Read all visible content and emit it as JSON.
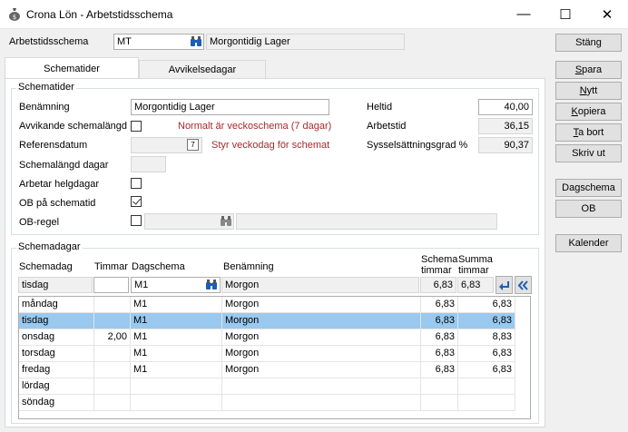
{
  "window": {
    "title": "Crona Lön - Arbetstidsschema",
    "min": "—",
    "max": "☐",
    "close": "✕"
  },
  "header": {
    "label": "Arbetstidsschema",
    "code": "MT",
    "name": "Morgontidig Lager"
  },
  "tabs": [
    {
      "label": "Schematider"
    },
    {
      "label": "Avvikelsedagar"
    }
  ],
  "schematider": {
    "title": "Schematider",
    "benamning_label": "Benämning",
    "benamning_value": "Morgontidig Lager",
    "avvikande_label": "Avvikande schemalängd",
    "avvikande_note": "Normalt är veckoschema (7 dagar)",
    "referensdatum_label": "Referensdatum",
    "referensdatum_note": "Styr veckodag för schemat",
    "calendar_glyph": "7",
    "schemalangd_label": "Schemalängd dagar",
    "arbetar_helgdagar_label": "Arbetar helgdagar",
    "ob_pa_schematid_label": "OB på schematid",
    "ob_regel_label": "OB-regel",
    "heltid_label": "Heltid",
    "heltid_value": "40,00",
    "arbetstid_label": "Arbetstid",
    "arbetstid_value": "36,15",
    "syss_label": "Sysselsättningsgrad %",
    "syss_value": "90,37"
  },
  "schemadagar": {
    "title": "Schemadagar",
    "col_schemadag": "Schemadag",
    "col_timmar": "Timmar",
    "col_dagschema": "Dagschema",
    "col_benamning": "Benämning",
    "col_schema_timmar_1": "Schema",
    "col_schema_timmar_2": "timmar",
    "col_summa_timmar_1": "Summa",
    "col_summa_timmar_2": "timmar",
    "edit": {
      "day": "tisdag",
      "timmar": "",
      "dagschema": "M1",
      "benamning": "Morgon",
      "schema_timmar": "6,83",
      "summa_timmar": "6,83"
    },
    "rows": [
      {
        "day": "måndag",
        "timmar": "",
        "dagschema": "M1",
        "benamning": "Morgon",
        "schema_timmar": "6,83",
        "summa_timmar": "6,83"
      },
      {
        "day": "tisdag",
        "timmar": "",
        "dagschema": "M1",
        "benamning": "Morgon",
        "schema_timmar": "6,83",
        "summa_timmar": "6,83"
      },
      {
        "day": "onsdag",
        "timmar": "2,00",
        "dagschema": "M1",
        "benamning": "Morgon",
        "schema_timmar": "6,83",
        "summa_timmar": "8,83"
      },
      {
        "day": "torsdag",
        "timmar": "",
        "dagschema": "M1",
        "benamning": "Morgon",
        "schema_timmar": "6,83",
        "summa_timmar": "6,83"
      },
      {
        "day": "fredag",
        "timmar": "",
        "dagschema": "M1",
        "benamning": "Morgon",
        "schema_timmar": "6,83",
        "summa_timmar": "6,83"
      },
      {
        "day": "lördag",
        "timmar": "",
        "dagschema": "",
        "benamning": "",
        "schema_timmar": "",
        "summa_timmar": ""
      },
      {
        "day": "söndag",
        "timmar": "",
        "dagschema": "",
        "benamning": "",
        "schema_timmar": "",
        "summa_timmar": ""
      }
    ]
  },
  "buttons": {
    "stang": "Stäng",
    "spara_pre": "",
    "spara_u": "S",
    "spara_post": "para",
    "nytt_pre": "",
    "nytt_u": "N",
    "nytt_post": "ytt",
    "kopiera_pre": "",
    "kopiera_u": "K",
    "kopiera_post": "opiera",
    "tabort_pre": "",
    "tabort_u": "T",
    "tabort_post": "a bort",
    "skrivut": "Skriv ut",
    "dagschema": "Dagschema",
    "ob": "OB",
    "kalender": "Kalender"
  },
  "colors": {
    "selection": "#99c9ef",
    "note_red": "#a52a2a",
    "accent_blue": "#1e5eb4"
  }
}
